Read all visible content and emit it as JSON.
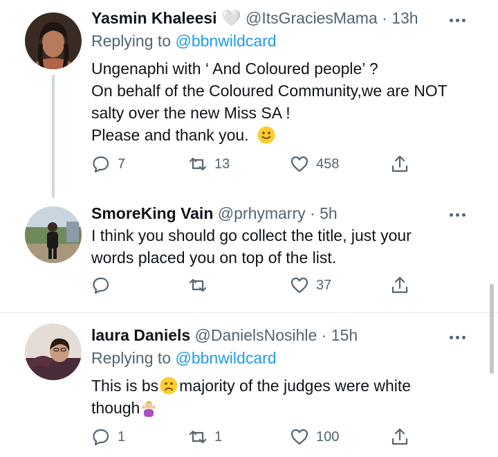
{
  "tweets": [
    {
      "name": "Yasmin Khaleesi",
      "name_badge": "🤍",
      "handle": "@ItsGraciesMama",
      "separator": "·",
      "time": "13h",
      "reply_prefix": "Replying to",
      "reply_mention": "@bbnwildcard",
      "text_lines": [
        "Ungenaphi with ‘ And Coloured people’ ?",
        "On behalf of the Coloured Community,we are NOT",
        "salty over the new Miss SA !",
        "Please and thank you."
      ],
      "reply_count": "7",
      "retweet_count": "13",
      "like_count": "458"
    },
    {
      "name": "SmoreKing Vain",
      "handle": "@prhymarry",
      "separator": "·",
      "time": "5h",
      "text_lines": [
        "I think you should go collect the title, just your",
        "words placed you on top of the list."
      ],
      "reply_count": "",
      "retweet_count": "",
      "like_count": "37"
    },
    {
      "name": "laura Daniels",
      "handle": "@DanielsNosihle",
      "separator": "·",
      "time": "15h",
      "reply_prefix": "Replying to",
      "reply_mention": "@bbnwildcard",
      "text_line1_a": "This is bs",
      "text_line1_b": "majority of the judges were white",
      "text_line2": "though",
      "reply_count": "1",
      "retweet_count": "1",
      "like_count": "100"
    }
  ],
  "icons": {
    "reply": "reply-icon",
    "retweet": "retweet-icon",
    "like": "heart-icon",
    "share": "share-icon",
    "more": "more-icon"
  },
  "colors": {
    "link": "#1d9bf0",
    "secondary": "#536471",
    "text": "#0f1419"
  }
}
